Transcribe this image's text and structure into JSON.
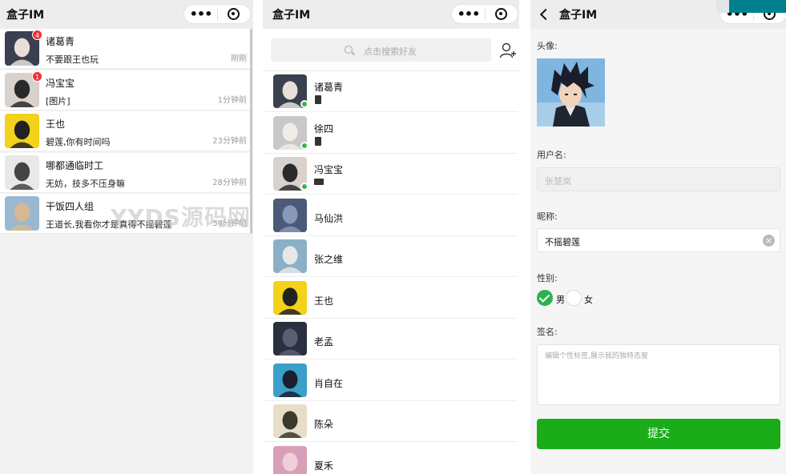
{
  "app_title": "盒子IM",
  "colors": {
    "accent_green": "#1aad19",
    "badge_red": "#f23030",
    "online_green": "#3ab64c"
  },
  "chat_list": [
    {
      "name": "诸葛青",
      "message": "不要跟王也玩",
      "time": "刚刚",
      "badge": "4",
      "avatar_bg": "#3a4050",
      "avatar_fg": "#e8e0d8"
    },
    {
      "name": "冯宝宝",
      "message": "[图片]",
      "time": "1分钟前",
      "badge": "1",
      "avatar_bg": "#d9d2cc",
      "avatar_fg": "#2a2a2a"
    },
    {
      "name": "王也",
      "message": "碧莲,你有时间吗",
      "time": "23分钟前",
      "badge": "",
      "avatar_bg": "#f2d21a",
      "avatar_fg": "#222"
    },
    {
      "name": "哪都通临时工",
      "message": "无妨，技多不压身嘛",
      "time": "28分钟前",
      "badge": "",
      "avatar_bg": "#e8e8e8",
      "avatar_fg": "#444"
    },
    {
      "name": "干饭四人组",
      "message": "王道长,我看你才是真得不摇碧莲",
      "time": "54分钟前",
      "badge": "",
      "avatar_bg": "#9ab8d0",
      "avatar_fg": "#d8b890"
    }
  ],
  "watermark": "YYDS源码网",
  "contacts": {
    "search_placeholder": "点击搜索好友",
    "items": [
      {
        "name": "诸葛青",
        "online": true,
        "device": "phone",
        "avatar_bg": "#3a4050",
        "avatar_fg": "#e8e0d8"
      },
      {
        "name": "徐四",
        "online": true,
        "device": "phone",
        "avatar_bg": "#c8c8c8",
        "avatar_fg": "#f0ece8"
      },
      {
        "name": "冯宝宝",
        "online": true,
        "device": "pc",
        "avatar_bg": "#d9d2cc",
        "avatar_fg": "#2a2a2a"
      },
      {
        "name": "马仙洪",
        "online": false,
        "device": "",
        "avatar_bg": "#4a5a78",
        "avatar_fg": "#8898b8"
      },
      {
        "name": "张之维",
        "online": false,
        "device": "",
        "avatar_bg": "#8ab0c8",
        "avatar_fg": "#e8e8e8"
      },
      {
        "name": "王也",
        "online": false,
        "device": "",
        "avatar_bg": "#f2d21a",
        "avatar_fg": "#222"
      },
      {
        "name": "老孟",
        "online": false,
        "device": "",
        "avatar_bg": "#2a3040",
        "avatar_fg": "#5a6070"
      },
      {
        "name": "肖自在",
        "online": false,
        "device": "",
        "avatar_bg": "#3aa0c8",
        "avatar_fg": "#1a2030"
      },
      {
        "name": "陈朵",
        "online": false,
        "device": "",
        "avatar_bg": "#e8ddc8",
        "avatar_fg": "#3a3a2a"
      },
      {
        "name": "夏禾",
        "online": false,
        "device": "",
        "avatar_bg": "#d8a0b8",
        "avatar_fg": "#f0d0d8"
      }
    ]
  },
  "profile": {
    "avatar_label": "头像:",
    "username_label": "用户名:",
    "username_value": "张楚岚",
    "nickname_label": "昵称:",
    "nickname_value": "不摇碧莲",
    "gender_label": "性别:",
    "gender_male": "男",
    "gender_female": "女",
    "signature_label": "签名:",
    "signature_placeholder": "编辑个性标签,展示我的独特态度",
    "submit_label": "提交"
  }
}
